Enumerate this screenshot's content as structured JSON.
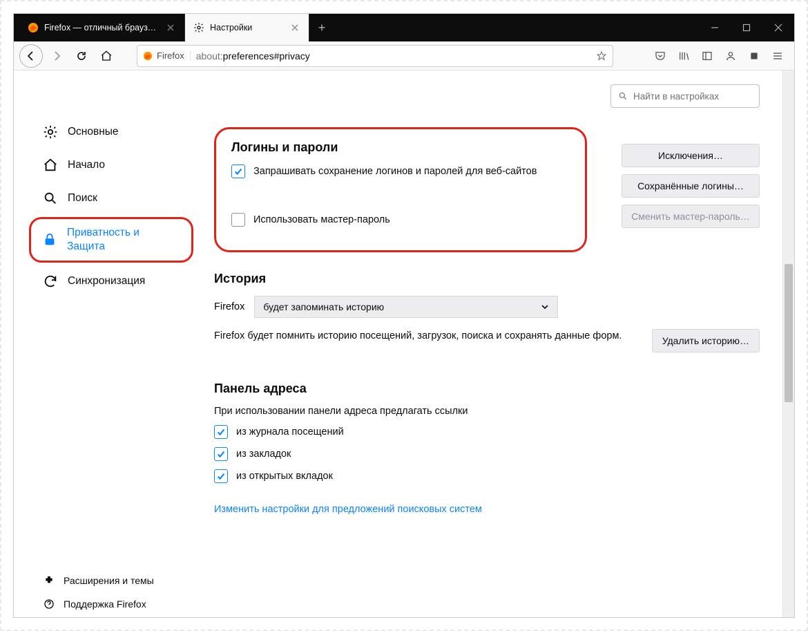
{
  "tabs": {
    "inactive": {
      "label": "Firefox — отличный браузер д"
    },
    "active": {
      "label": "Настройки"
    }
  },
  "urlbar": {
    "identity_label": "Firefox",
    "url_prefix": "about:",
    "url_rest": "preferences#privacy"
  },
  "search": {
    "placeholder": "Найти в настройках"
  },
  "sidebar": {
    "items": [
      {
        "label": "Основные"
      },
      {
        "label": "Начало"
      },
      {
        "label": "Поиск"
      },
      {
        "label": "Приватность и Защита"
      },
      {
        "label": "Синхронизация"
      }
    ],
    "bottom": [
      {
        "label": "Расширения и темы"
      },
      {
        "label": "Поддержка Firefox"
      }
    ]
  },
  "logins": {
    "heading": "Логины и пароли",
    "ask_save": "Запрашивать сохранение логинов и паролей для веб-сайтов",
    "use_master": "Использовать мастер-пароль",
    "btn_exceptions": "Исключения…",
    "btn_saved": "Сохранённые логины…",
    "btn_change_master": "Сменить мастер-пароль…"
  },
  "history": {
    "heading": "История",
    "prefix": "Firefox",
    "dropdown": "будет запоминать историю",
    "desc": "Firefox будет помнить историю посещений, загрузок, поиска и сохранять данные форм.",
    "btn_clear": "Удалить историю…"
  },
  "addressbar": {
    "heading": "Панель адреса",
    "sub": "При использовании панели адреса предлагать ссылки",
    "opt_history": "из журнала посещений",
    "opt_bookmarks": "из закладок",
    "opt_opentabs": "из открытых вкладок",
    "link": "Изменить настройки для предложений поисковых систем"
  }
}
